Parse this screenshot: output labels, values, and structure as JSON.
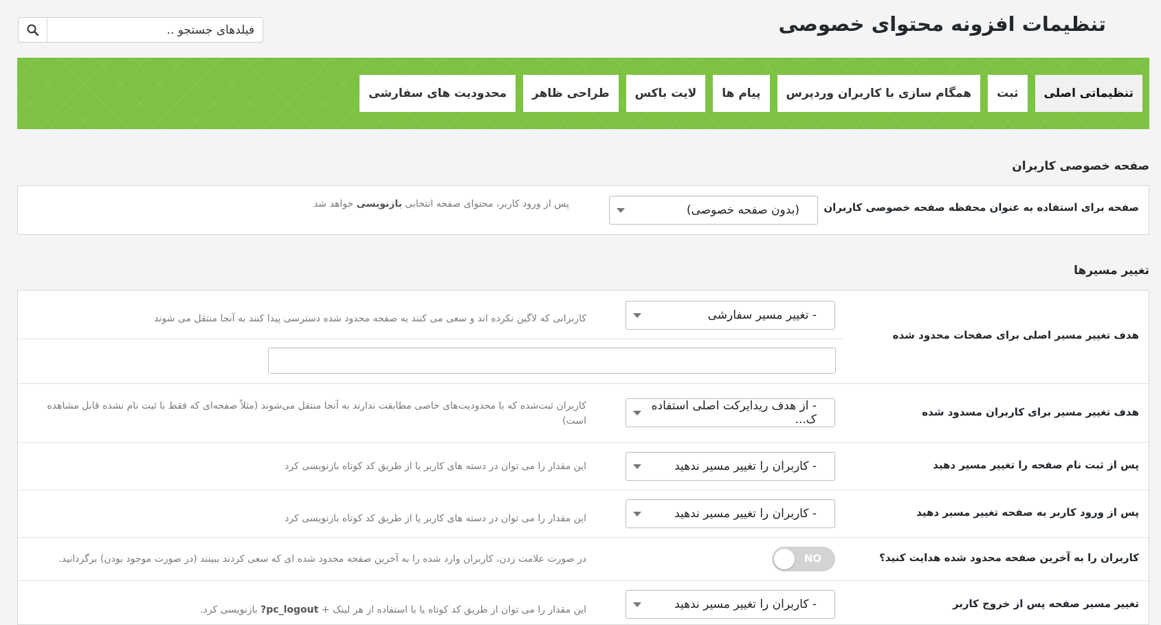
{
  "header": {
    "title": "تنظیمات افزونه محتوای خصوصی",
    "search_placeholder": "فیلدهای جستجو .."
  },
  "tabs": [
    {
      "label": "تنظیماتی اصلی",
      "active": true
    },
    {
      "label": "ثبت",
      "active": false
    },
    {
      "label": "همگام سازی با کاربران وردپرس",
      "active": false
    },
    {
      "label": "پیام ها",
      "active": false
    },
    {
      "label": "لایت باکس",
      "active": false
    },
    {
      "label": "طراحی ظاهر",
      "active": false
    },
    {
      "label": "محدودیت های سفارشی",
      "active": false
    }
  ],
  "colors": {
    "tab_bar": "#7dc242",
    "toggle_off": "#d3d3d3"
  },
  "private_page": {
    "section_title": "صفحه خصوصی کاربران",
    "label": "صفحه برای استفاده به عنوان محفظه صفحه خصوصی کاربران",
    "select_value": "(بدون صفحه خصوصی)",
    "hint_before": "پس از ورود کاربر، محتوای صفحه انتخابی ",
    "hint_bold": "بازنویسی",
    "hint_after": " خواهد شد"
  },
  "redirects": {
    "section_title": "تغییر مسیرها",
    "rows": [
      {
        "label": "هدف تغییر مسیر اصلی برای صفحات محدود شده",
        "select_value": "- تغییر مسیر سفارشی",
        "hint": "کاربرانی که لاگین نکرده اند و سعی می کنند به صفحه محدود شده دسترسی پیدا کنند به آنجا منتقل می شوند",
        "custom_url_value": ""
      },
      {
        "label": "هدف تغییر مسیر برای کاربران مسدود شده",
        "select_value": "- از هدف ریدایرکت اصلی استفاده ک...",
        "hint": "کاربران ثبت‌شده که با محدودیت‌های خاصی مطابقت ندارند به آنجا منتقل می‌شوند (مثلاً صفحه‌ای که فقط با ثبت نام نشده قابل مشاهده است)"
      },
      {
        "label": "پس از ثبت نام صفحه را تغییر مسیر دهید",
        "select_value": "- کاربران را تغییر مسیر ندهید",
        "hint": "این مقدار را می توان در دسته های کاربر یا از طریق کد کوتاه بازنویسی کرد"
      },
      {
        "label": "پس از ورود کاربر به صفحه تغییر مسیر دهید",
        "select_value": "- کاربران را تغییر مسیر ندهید",
        "hint": "این مقدار را می توان در دسته های کاربر یا از طریق کد کوتاه بازنویسی کرد"
      },
      {
        "label": "کاربران را به آخرین صفحه محدود شده هدایت کنید؟",
        "toggle_text": "NO",
        "toggle_on": false,
        "hint": "در صورت علامت زدن، کاربران وارد شده را به آخرین صفحه محدود شده ای که سعی کردند ببینند (در صورت موجود بودن) برگردانید."
      },
      {
        "label": "تغییر مسیر صفحه پس از خروج کاربر",
        "select_value": "- کاربران را تغییر مسیر ندهید",
        "hint_before": "این مقدار را می توان از طریق کد کوتاه یا با استفاده از هر لینک + ",
        "hint_code": "?pc_logout",
        "hint_after": " بازنویسی کرد."
      }
    ]
  }
}
